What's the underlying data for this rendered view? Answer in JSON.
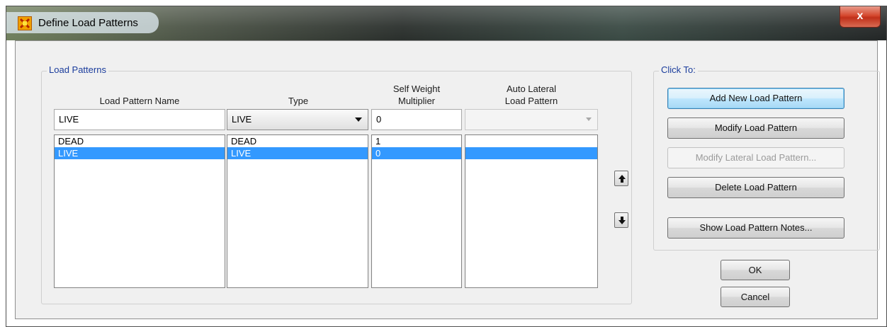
{
  "window": {
    "title": "Define Load Patterns",
    "close_label": "x"
  },
  "load_patterns": {
    "group_label": "Load Patterns",
    "headers": {
      "name": "Load Pattern Name",
      "type": "Type",
      "self_weight_line1": "Self Weight",
      "self_weight_line2": "Multiplier",
      "auto_lateral_line1": "Auto Lateral",
      "auto_lateral_line2": "Load Pattern"
    },
    "edit": {
      "name": "LIVE",
      "type": "LIVE",
      "multiplier": "0",
      "auto_lateral": ""
    },
    "rows": [
      {
        "name": "DEAD",
        "type": "DEAD",
        "multiplier": "1",
        "auto_lateral": ""
      },
      {
        "name": "LIVE",
        "type": "LIVE",
        "multiplier": "0",
        "auto_lateral": ""
      }
    ],
    "selected_index": 1
  },
  "click_to": {
    "group_label": "Click To:",
    "add": "Add New Load Pattern",
    "modify": "Modify Load Pattern",
    "modify_lateral": "Modify Lateral Load Pattern...",
    "delete": "Delete Load Pattern",
    "notes": "Show Load Pattern Notes..."
  },
  "footer": {
    "ok": "OK",
    "cancel": "Cancel"
  },
  "icons": {
    "app": "sap-app-icon",
    "move_up": "arrow-up-icon",
    "move_down": "arrow-down-icon",
    "dropdown": "chevron-down-icon"
  },
  "colors": {
    "selection": "#3399ff",
    "group_label": "#1a3c9c"
  }
}
